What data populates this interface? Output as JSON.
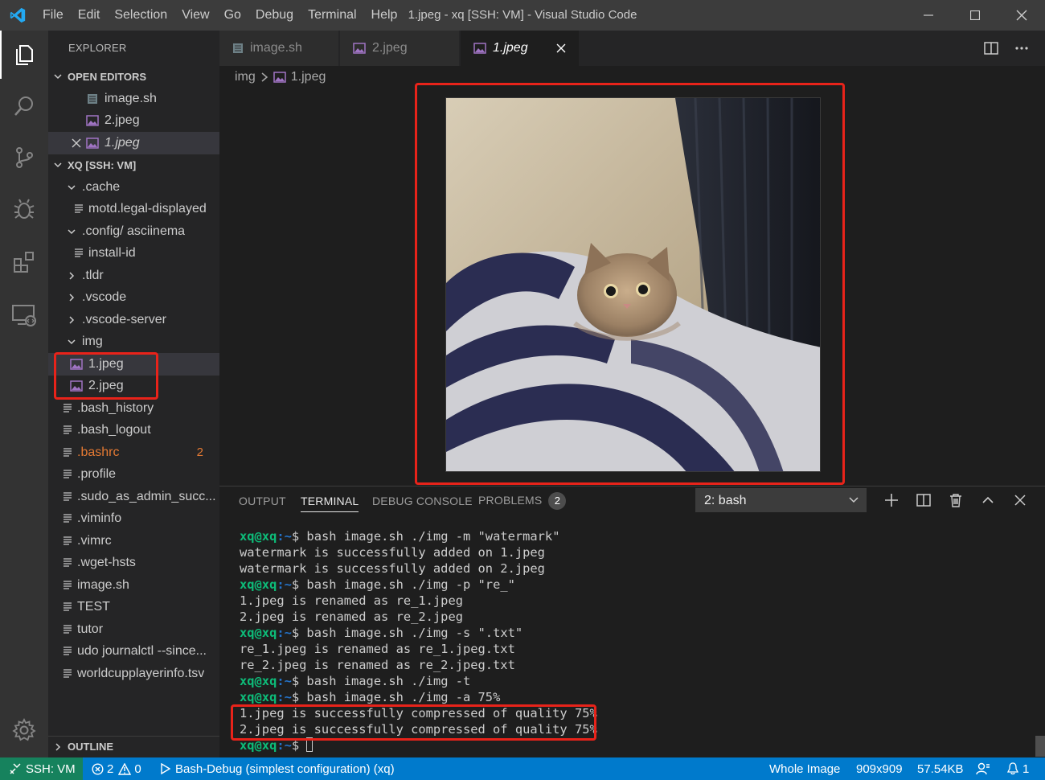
{
  "window": {
    "title": "1.jpeg - xq [SSH: VM] - Visual Studio Code",
    "menu": [
      "File",
      "Edit",
      "Selection",
      "View",
      "Go",
      "Debug",
      "Terminal",
      "Help"
    ]
  },
  "activity_bar": [
    "explorer-icon",
    "search-icon",
    "source-control-icon",
    "debug-icon",
    "extensions-icon",
    "remote-explorer-icon",
    "gear-icon"
  ],
  "sidebar": {
    "title": "EXPLORER",
    "open_editors": {
      "label": "OPEN EDITORS",
      "items": [
        {
          "name": "image.sh",
          "icon": "file-lines-icon"
        },
        {
          "name": "2.jpeg",
          "icon": "image-icon"
        },
        {
          "name": "1.jpeg",
          "icon": "image-icon",
          "active": true
        }
      ]
    },
    "workspace": {
      "label": "XQ [SSH: VM]",
      "items": [
        {
          "name": ".cache",
          "type": "folder-open"
        },
        {
          "name": "motd.legal-displayed",
          "type": "file"
        },
        {
          "name": ".config",
          "suffix": " / asciinema",
          "type": "folder-open"
        },
        {
          "name": "install-id",
          "type": "file"
        },
        {
          "name": ".tldr",
          "type": "folder"
        },
        {
          "name": ".vscode",
          "type": "folder"
        },
        {
          "name": ".vscode-server",
          "type": "folder"
        },
        {
          "name": "img",
          "type": "folder-open"
        },
        {
          "name": "1.jpeg",
          "type": "image"
        },
        {
          "name": "2.jpeg",
          "type": "image"
        },
        {
          "name": ".bash_history",
          "type": "file"
        },
        {
          "name": ".bash_logout",
          "type": "file"
        },
        {
          "name": ".bashrc",
          "type": "file",
          "badge": "2"
        },
        {
          "name": ".profile",
          "type": "file"
        },
        {
          "name": ".sudo_as_admin_succ...",
          "type": "file"
        },
        {
          "name": ".viminfo",
          "type": "file"
        },
        {
          "name": ".vimrc",
          "type": "file"
        },
        {
          "name": ".wget-hsts",
          "type": "file"
        },
        {
          "name": "image.sh",
          "type": "file"
        },
        {
          "name": "TEST",
          "type": "file"
        },
        {
          "name": "tutor",
          "type": "file"
        },
        {
          "name": "udo journalctl --since...",
          "type": "file"
        },
        {
          "name": "worldcupplayerinfo.tsv",
          "type": "file"
        }
      ]
    },
    "outline_label": "OUTLINE"
  },
  "tabs": [
    {
      "label": "image.sh"
    },
    {
      "label": "2.jpeg"
    },
    {
      "label": "1.jpeg",
      "active": true
    }
  ],
  "breadcrumb": {
    "folder": "img",
    "file": "1.jpeg"
  },
  "panel": {
    "tabs": {
      "output": "OUTPUT",
      "terminal": "TERMINAL",
      "debug": "DEBUG CONSOLE",
      "problems": "PROBLEMS",
      "problems_count": "2"
    },
    "terminal_select": "2: bash",
    "prompt_user": "xq@xq",
    "prompt_path": ":~",
    "lines": [
      {
        "cmd": "$ bash image.sh ./img -m \"watermark\""
      },
      {
        "out": "watermark is successfully added on 1.jpeg"
      },
      {
        "out": "watermark is successfully added on 2.jpeg"
      },
      {
        "cmd": "$ bash image.sh ./img -p \"re_\""
      },
      {
        "out": "1.jpeg is renamed as re_1.jpeg"
      },
      {
        "out": "2.jpeg is renamed as re_2.jpeg"
      },
      {
        "cmd": "$ bash image.sh ./img -s \".txt\""
      },
      {
        "out": "re_1.jpeg is renamed as re_1.jpeg.txt"
      },
      {
        "out": "re_2.jpeg is renamed as re_2.jpeg.txt"
      },
      {
        "cmd": "$ bash image.sh ./img -t"
      },
      {
        "cmd": "$ bash image.sh ./img -a 75%"
      },
      {
        "out": "1.jpeg is successfully compressed of quality 75%"
      },
      {
        "out": "2.jpeg is successfully compressed of quality 75%"
      },
      {
        "cmd": "$ ",
        "cursor": true
      }
    ]
  },
  "statusbar": {
    "remote": "SSH: VM",
    "errors": "2",
    "warnings": "0",
    "debug": "Bash-Debug (simplest configuration) (xq)",
    "image_mode": "Whole Image",
    "dimensions": "909x909",
    "size": "57.54KB",
    "notifications": "1"
  },
  "colors": {
    "accent": "#007acc",
    "remote": "#16825d",
    "highlight": "#e8231a",
    "prompt_user": "#0dbc79",
    "prompt_path": "#2472c8"
  }
}
